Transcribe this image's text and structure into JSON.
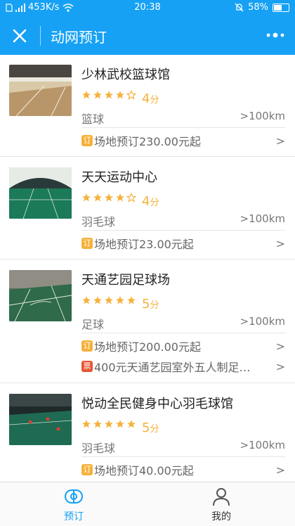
{
  "status_bar": {
    "network_speed": "453K/s",
    "time": "20:38",
    "battery": "58%"
  },
  "app_bar": {
    "title": "动网预订",
    "close_icon": "close-icon",
    "more_icon": "more-horizontal-icon"
  },
  "colors": {
    "primary": "#16a1f5",
    "star": "#f6b13b",
    "tag_booking": "#f6b13b",
    "tag_ticket": "#e65532"
  },
  "venues": [
    {
      "name": "少林武校篮球馆",
      "rating": 4,
      "score": "4",
      "score_unit": "分",
      "sport": "篮球",
      "distance": ">100km",
      "offers": [
        {
          "tag": "订",
          "text": "场地预订230.00元起",
          "arrow": ">"
        }
      ]
    },
    {
      "name": "天天运动中心",
      "rating": 4,
      "score": "4",
      "score_unit": "分",
      "sport": "羽毛球",
      "distance": ">100km",
      "offers": [
        {
          "tag": "订",
          "text": "场地预订23.00元起",
          "arrow": ">"
        }
      ]
    },
    {
      "name": "天通艺园足球场",
      "rating": 5,
      "score": "5",
      "score_unit": "分",
      "sport": "足球",
      "distance": ">100km",
      "offers": [
        {
          "tag": "订",
          "text": "场地预订200.00元起",
          "arrow": ">"
        },
        {
          "tag": "票",
          "text": "400元天通艺园室外五人制足…",
          "arrow": ">"
        }
      ]
    },
    {
      "name": "悦动全民健身中心羽毛球馆",
      "rating": 5,
      "score": "5",
      "score_unit": "分",
      "sport": "羽毛球",
      "distance": ">100km",
      "offers": [
        {
          "tag": "订",
          "text": "场地预订40.00元起",
          "arrow": ">"
        }
      ]
    }
  ],
  "tab_bar": {
    "tabs": [
      {
        "label": "预订",
        "icon": "court-icon",
        "active": true
      },
      {
        "label": "我的",
        "icon": "person-icon",
        "active": false
      }
    ]
  }
}
